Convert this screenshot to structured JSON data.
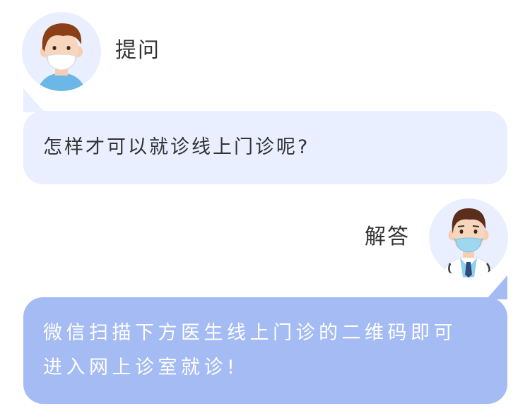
{
  "question": {
    "avatar_icon": "patient-avatar-icon",
    "label": "提问",
    "text": "怎样才可以就诊线上门诊呢?"
  },
  "answer": {
    "avatar_icon": "doctor-avatar-icon",
    "label": "解答",
    "lines": [
      "微信扫描下方医生线上门诊的二维码即可",
      "进入网上诊室就诊!"
    ]
  },
  "colors": {
    "question_bubble": "#e9efff",
    "answer_bubble": "#a4bbf3",
    "text_dark": "#333333",
    "text_light": "#ffffff"
  }
}
